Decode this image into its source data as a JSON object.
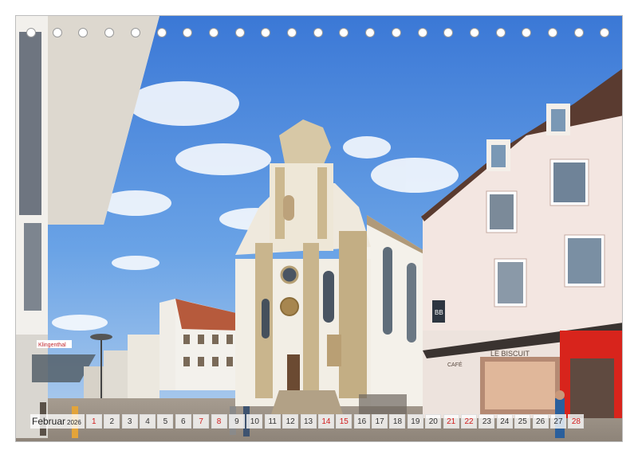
{
  "calendar": {
    "month": "Februar",
    "year": "2026",
    "days": [
      {
        "n": "1",
        "weekend": true
      },
      {
        "n": "2",
        "weekend": false
      },
      {
        "n": "3",
        "weekend": false
      },
      {
        "n": "4",
        "weekend": false
      },
      {
        "n": "5",
        "weekend": false
      },
      {
        "n": "6",
        "weekend": false
      },
      {
        "n": "7",
        "weekend": true
      },
      {
        "n": "8",
        "weekend": true
      },
      {
        "n": "9",
        "weekend": false
      },
      {
        "n": "10",
        "weekend": false
      },
      {
        "n": "11",
        "weekend": false
      },
      {
        "n": "12",
        "weekend": false
      },
      {
        "n": "13",
        "weekend": false
      },
      {
        "n": "14",
        "weekend": true
      },
      {
        "n": "15",
        "weekend": true
      },
      {
        "n": "16",
        "weekend": false
      },
      {
        "n": "17",
        "weekend": false
      },
      {
        "n": "18",
        "weekend": false
      },
      {
        "n": "19",
        "weekend": false
      },
      {
        "n": "20",
        "weekend": false
      },
      {
        "n": "21",
        "weekend": true
      },
      {
        "n": "22",
        "weekend": true
      },
      {
        "n": "23",
        "weekend": false
      },
      {
        "n": "24",
        "weekend": false
      },
      {
        "n": "25",
        "weekend": false
      },
      {
        "n": "26",
        "weekend": false
      },
      {
        "n": "27",
        "weekend": false
      },
      {
        "n": "28",
        "weekend": true
      }
    ]
  },
  "photo": {
    "signs": {
      "store_sign": "Klingenthal",
      "shop_sign": "LE BISCUIT",
      "shop_sign_small": "CAFÉ",
      "hanging_sign": "BB"
    }
  },
  "binding": {
    "hole_count": 23
  }
}
